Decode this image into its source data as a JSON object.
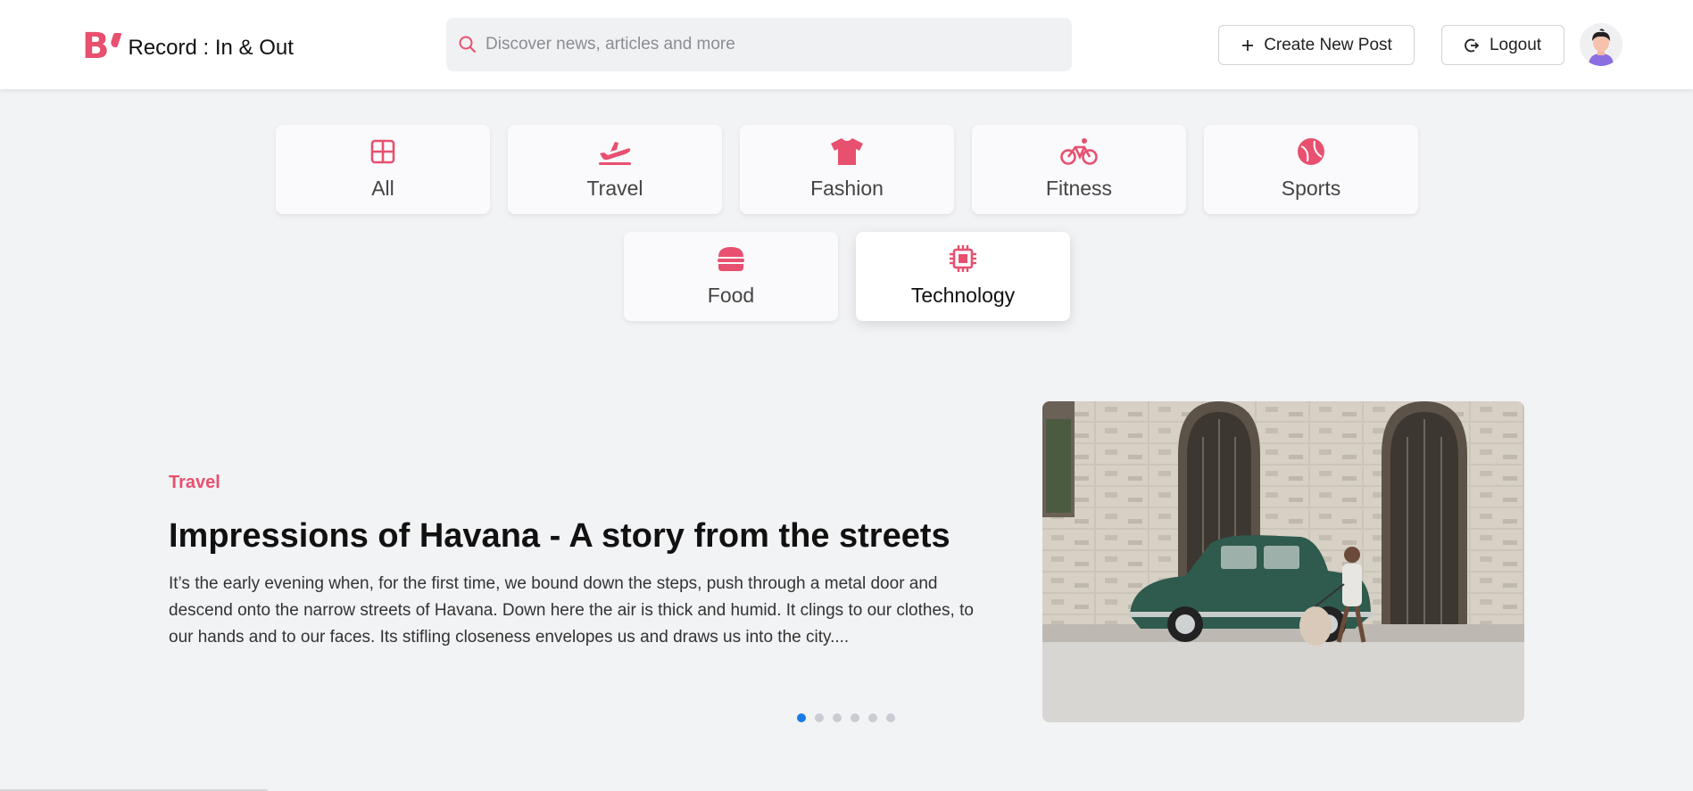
{
  "brand": {
    "mark": "B",
    "name": "Record : In & Out",
    "color": "#e8506f"
  },
  "search": {
    "placeholder": "Discover news, articles and more",
    "value": "",
    "icon": "search-icon"
  },
  "header": {
    "create_label": "Create New Post",
    "create_icon": "plus-icon",
    "logout_label": "Logout",
    "logout_icon": "logout-icon",
    "avatar_icon": "user-avatar"
  },
  "categories": [
    {
      "label": "All",
      "icon": "grid-icon"
    },
    {
      "label": "Travel",
      "icon": "plane-icon"
    },
    {
      "label": "Fashion",
      "icon": "tshirt-icon"
    },
    {
      "label": "Fitness",
      "icon": "bicycle-icon"
    },
    {
      "label": "Sports",
      "icon": "ball-icon"
    },
    {
      "label": "Food",
      "icon": "burger-icon"
    },
    {
      "label": "Technology",
      "icon": "chip-icon",
      "active": true
    }
  ],
  "featured": {
    "category": "Travel",
    "title": "Impressions of Havana - A story from the streets",
    "excerpt": "It’s the early evening when, for the first time, we bound down the steps, push through a metal door and descend onto the narrow streets of Havana. Down here the air is thick and humid. It clings to our clothes, to our hands and to our faces. Its stifling closeness envelopes us and draws us into the city....",
    "image": "havana-street-photo",
    "slide_count": 6,
    "active_slide": 1
  },
  "colors": {
    "accent": "#e8506f",
    "dot_active": "#1a7be6",
    "dot": "#c9ccd1",
    "page_bg": "#f2f3f5"
  }
}
